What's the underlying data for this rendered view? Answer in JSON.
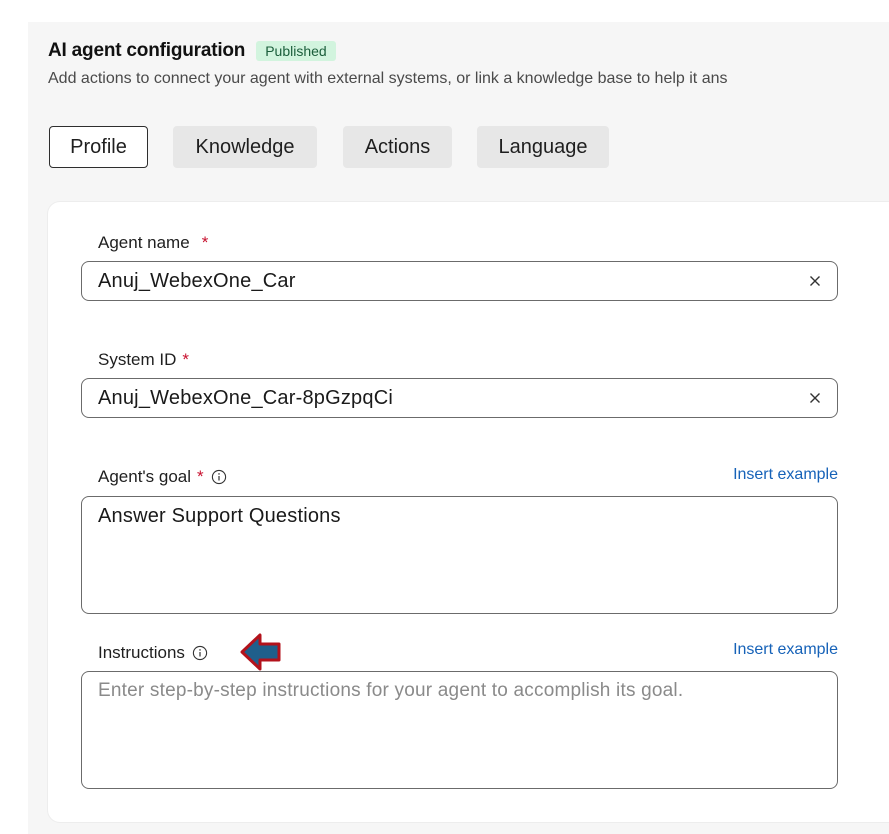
{
  "header": {
    "title": "AI agent configuration",
    "status_badge": "Published",
    "subtitle": "Add actions to connect your agent with external systems, or link a knowledge base to help it ans"
  },
  "tabs": [
    {
      "label": "Profile",
      "active": true
    },
    {
      "label": "Knowledge",
      "active": false
    },
    {
      "label": "Actions",
      "active": false
    },
    {
      "label": "Language",
      "active": false
    }
  ],
  "form": {
    "agent_name": {
      "label": "Agent name",
      "required_mark": "*",
      "value": "Anuj_WebexOne_Car"
    },
    "system_id": {
      "label": "System ID",
      "required_mark": "*",
      "value": "Anuj_WebexOne_Car-8pGzpqCi"
    },
    "agent_goal": {
      "label": "Agent's goal",
      "required_mark": "*",
      "value": "Answer Support Questions",
      "insert_link": "Insert example"
    },
    "instructions": {
      "label": "Instructions",
      "placeholder": "Enter step-by-step instructions for your agent to accomplish its goal.",
      "insert_link": "Insert example"
    }
  },
  "icons": {
    "clear": "close-icon",
    "info": "info-icon",
    "annotation": "arrow-left-annotation"
  },
  "colors": {
    "badge_bg": "#d2f4de",
    "badge_text": "#1b5e3b",
    "required": "#c8102e",
    "link": "#1662b8",
    "annotation_fill": "#1f5f8b",
    "annotation_outline": "#b3121b"
  }
}
